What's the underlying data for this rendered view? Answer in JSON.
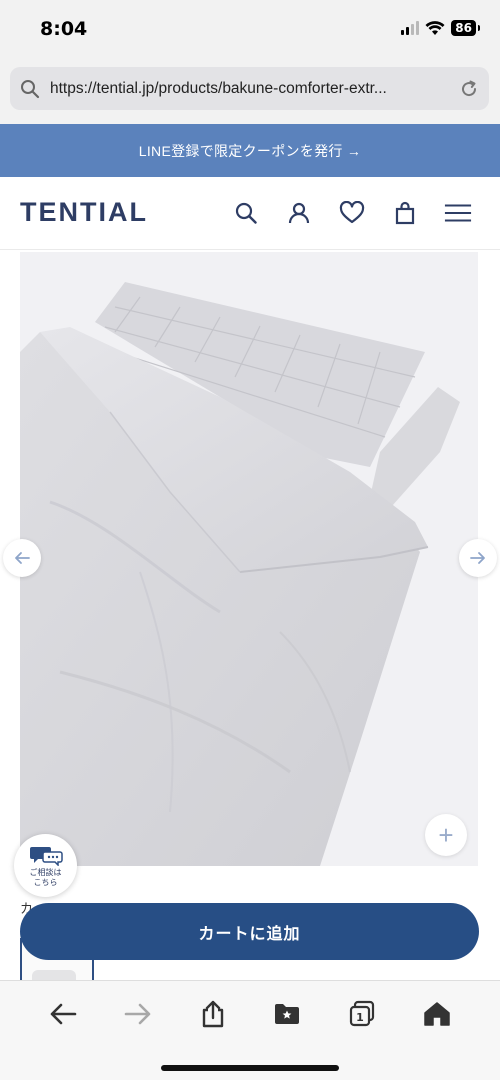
{
  "status_bar": {
    "time": "8:04",
    "battery": "86"
  },
  "browser": {
    "url": "https://tential.jp/products/bakune-comforter-extr..."
  },
  "banner": {
    "text": "LINE登録で限定クーポンを発行 →"
  },
  "header": {
    "logo": "TENTIAL",
    "icons": [
      "search-icon",
      "account-icon",
      "heart-icon",
      "bag-icon",
      "menu-icon"
    ]
  },
  "gallery": {
    "image_description_icon": "comforter-product-image",
    "zoom_symbol": "+"
  },
  "consult": {
    "label_line1": "ご相談は",
    "label_line2": "こちら"
  },
  "product": {
    "color_label": "カ",
    "cart_button_label": "カートに追加"
  },
  "colors": {
    "accent": "#274e85",
    "banner": "#5b82bc",
    "logo": "#2e3d64"
  },
  "toolbar": {
    "tabs_count": "1"
  }
}
